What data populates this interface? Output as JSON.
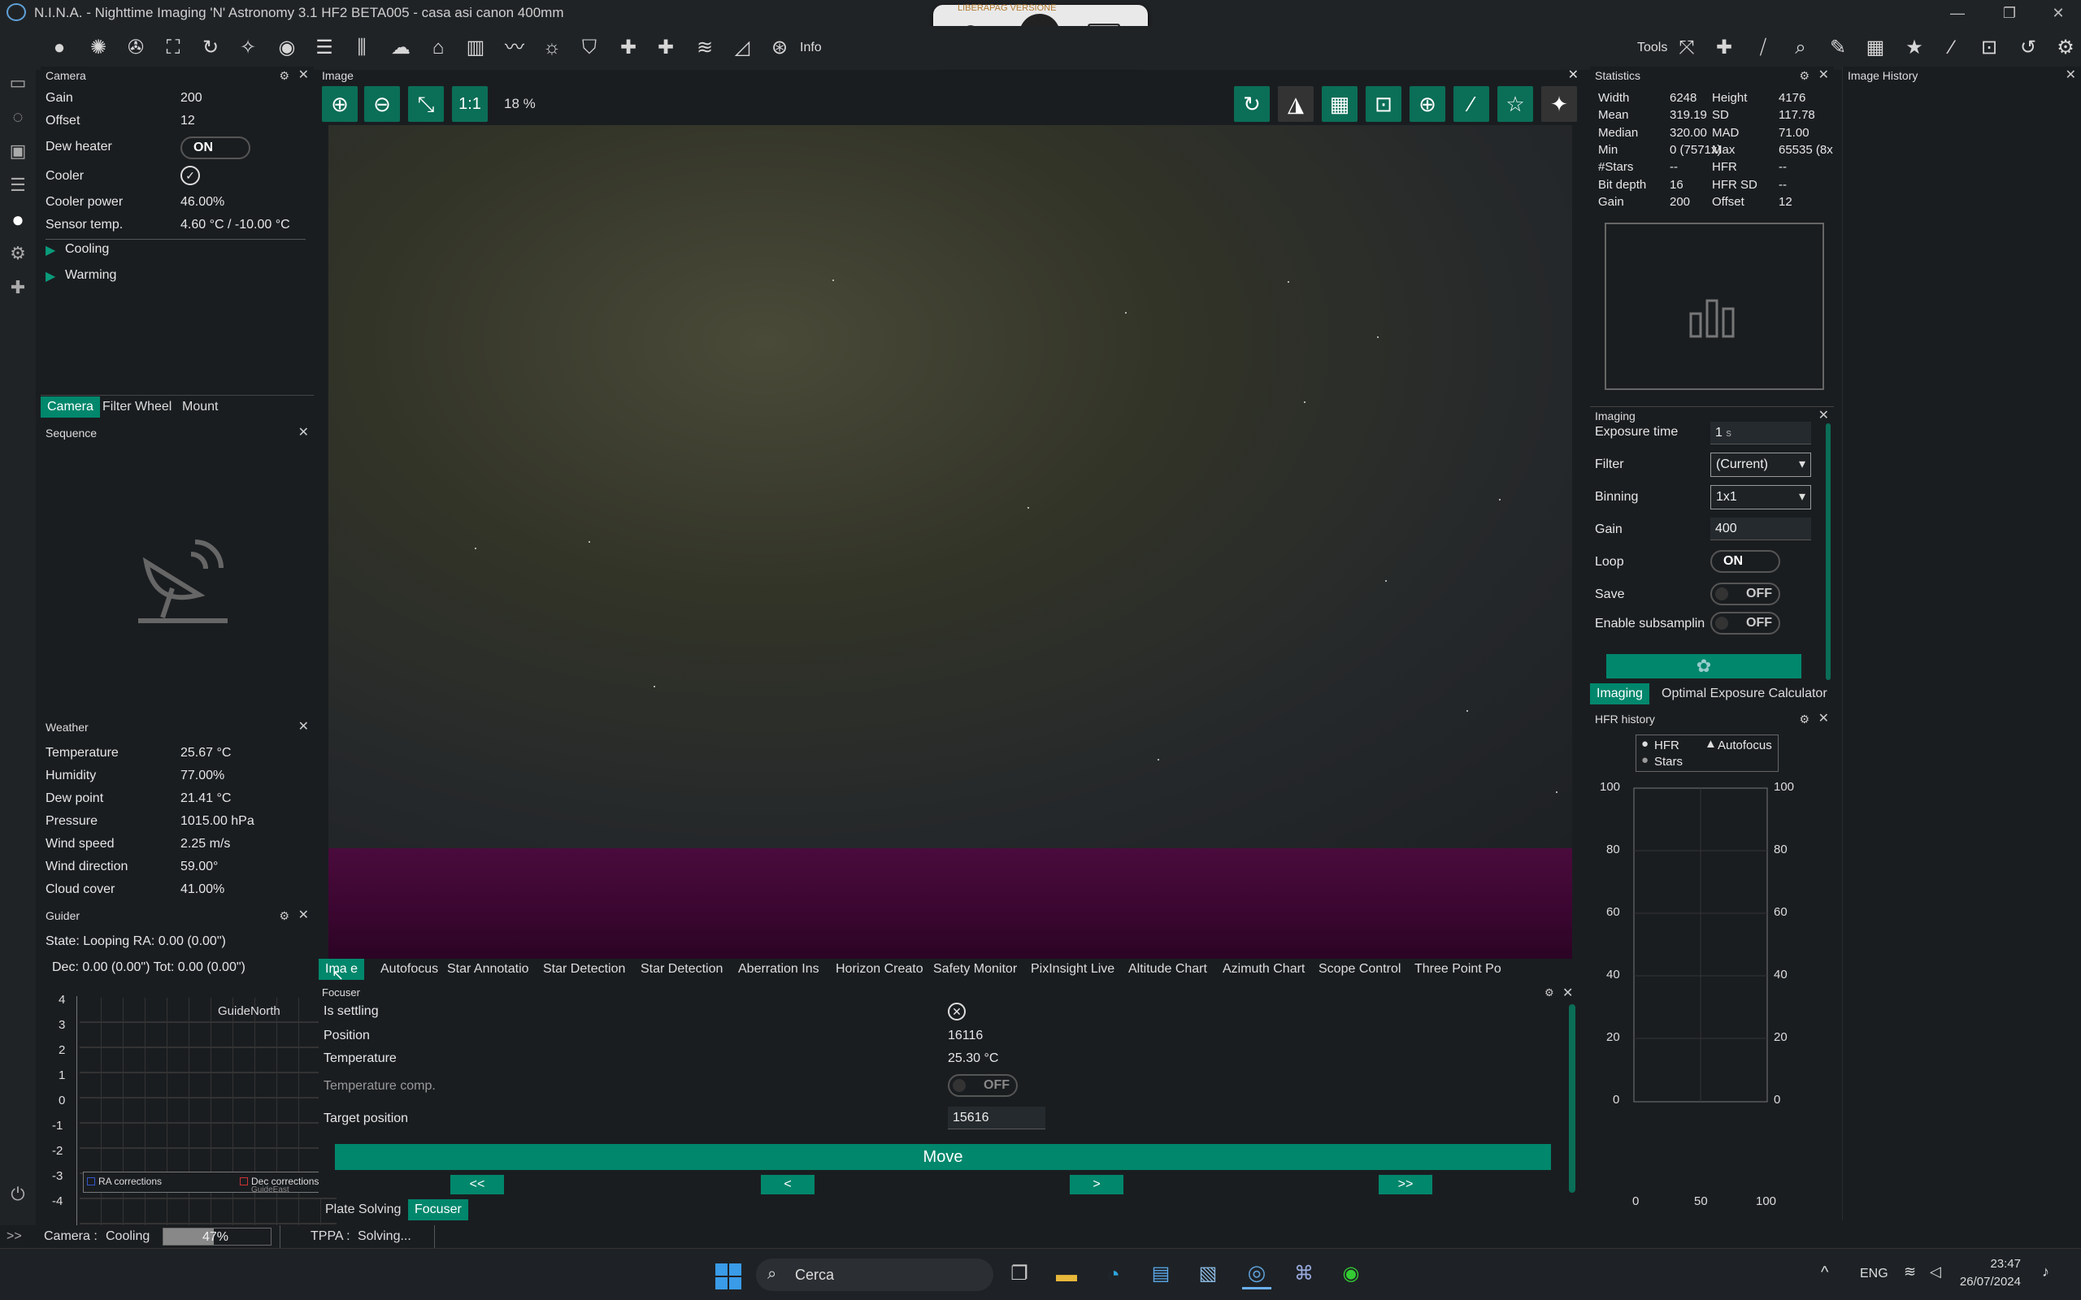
{
  "window": {
    "title": "N.I.N.A. - Nighttime Imaging 'N' Astronomy 3.1 HF2 BETA005   -  casa asi canon 400mm"
  },
  "remote": {
    "banner": "LIBERAPAG VERSIONE"
  },
  "toolbar": {
    "info_label": "Info",
    "tools_label": "Tools"
  },
  "camera": {
    "header": "Camera",
    "rows": [
      {
        "label": "Gain",
        "value": "200"
      },
      {
        "label": "Offset",
        "value": "12"
      },
      {
        "label": "Dew heater",
        "value": "ON"
      },
      {
        "label": "Cooler",
        "value": "✓"
      },
      {
        "label": "Cooler power",
        "value": "46.00%"
      },
      {
        "label": "Sensor temp.",
        "value": "4.60 °C / -10.00 °C"
      }
    ],
    "cooling": "Cooling",
    "warming": "Warming",
    "tabs": [
      "Camera",
      "Filter Wheel",
      "Mount"
    ]
  },
  "sequence": {
    "header": "Sequence"
  },
  "weather": {
    "header": "Weather",
    "rows": [
      {
        "label": "Temperature",
        "value": "25.67 °C"
      },
      {
        "label": "Humidity",
        "value": "77.00%"
      },
      {
        "label": "Dew point",
        "value": "21.41 °C"
      },
      {
        "label": "Pressure",
        "value": "1015.00 hPa"
      },
      {
        "label": "Wind speed",
        "value": "2.25 m/s"
      },
      {
        "label": "Wind direction",
        "value": "59.00°"
      },
      {
        "label": "Cloud cover",
        "value": "41.00%"
      }
    ]
  },
  "guider": {
    "header": "Guider",
    "state": "State: Looping  RA: 0.00 (0.00\")",
    "dec": "Dec: 0.00 (0.00\")  Tot: 0.00 (0.00\")",
    "chart_title": "GuideNorth",
    "yticks": [
      "4",
      "3",
      "2",
      "1",
      "0",
      "-1",
      "-2",
      "-3",
      "-4"
    ],
    "legend_ra": "RA corrections",
    "legend_dec": "Dec corrections",
    "legend_extra": "GuideEast"
  },
  "image": {
    "header": "Image",
    "zoom": "18 %",
    "one_to_one": "1:1"
  },
  "bottom_tabs": [
    "Ima e",
    "Autofocus",
    "Star Annotatio",
    "Star Detection",
    "Star Detection",
    "Aberration Ins",
    "Horizon Creato",
    "Safety Monitor",
    "PixInsight Live",
    "Altitude Chart",
    "Azimuth Chart",
    "Scope Control",
    "Three Point Po"
  ],
  "focuser": {
    "header": "Focuser",
    "is_settling_label": "Is settling",
    "position_label": "Position",
    "position_value": "16116",
    "temperature_label": "Temperature",
    "temperature_value": "25.30 °C",
    "temp_comp_label": "Temperature comp.",
    "temp_comp_value": "OFF",
    "target_label": "Target position",
    "target_value": "15616",
    "move_label": "Move",
    "step_ll": "<<",
    "step_l": "<",
    "step_r": ">",
    "step_rr": ">>",
    "tabs": [
      "Plate Solving",
      "Focuser"
    ]
  },
  "statistics": {
    "header": "Statistics",
    "rows": [
      [
        "Width",
        "6248",
        "Height",
        "4176"
      ],
      [
        "Mean",
        "319.19",
        "SD",
        "117.78"
      ],
      [
        "Median",
        "320.00",
        "MAD",
        "71.00"
      ],
      [
        "Min",
        "0 (7571x)",
        "Max",
        "65535 (8x"
      ],
      [
        "#Stars",
        "--",
        "HFR",
        "--"
      ],
      [
        "Bit depth",
        "16",
        "HFR SD",
        "--"
      ],
      [
        "Gain",
        "200",
        "Offset",
        "12"
      ]
    ]
  },
  "image_history": {
    "header": "Image History"
  },
  "imaging": {
    "header": "Imaging",
    "exposure_label": "Exposure time",
    "exposure_value": "1",
    "exposure_unit": "s",
    "filter_label": "Filter",
    "filter_value": "(Current)",
    "binning_label": "Binning",
    "binning_value": "1x1",
    "gain_label": "Gain",
    "gain_value": "400",
    "loop_label": "Loop",
    "loop_value": "ON",
    "save_label": "Save",
    "save_value": "OFF",
    "subsampling_label": "Enable subsamplin",
    "subsampling_value": "OFF",
    "tabs": [
      "Imaging",
      "Optimal Exposure Calculator"
    ]
  },
  "hfr": {
    "header": "HFR history",
    "legend_hfr": "HFR",
    "legend_af": "Autofocus",
    "legend_stars": "Stars",
    "yticks": [
      "100",
      "80",
      "60",
      "40",
      "20",
      "0"
    ],
    "xticks": [
      "0",
      "50",
      "100"
    ]
  },
  "statusbar": {
    "camera_label": "Camera :",
    "camera_state": "Cooling",
    "camera_progress": "47%",
    "camera_progress_value": 47,
    "tppa_label": "TPPA :",
    "tppa_state": "Solving..."
  },
  "taskbar": {
    "search_placeholder": "Cerca",
    "lang": "ENG",
    "time": "23:47",
    "date": "26/07/2024"
  }
}
